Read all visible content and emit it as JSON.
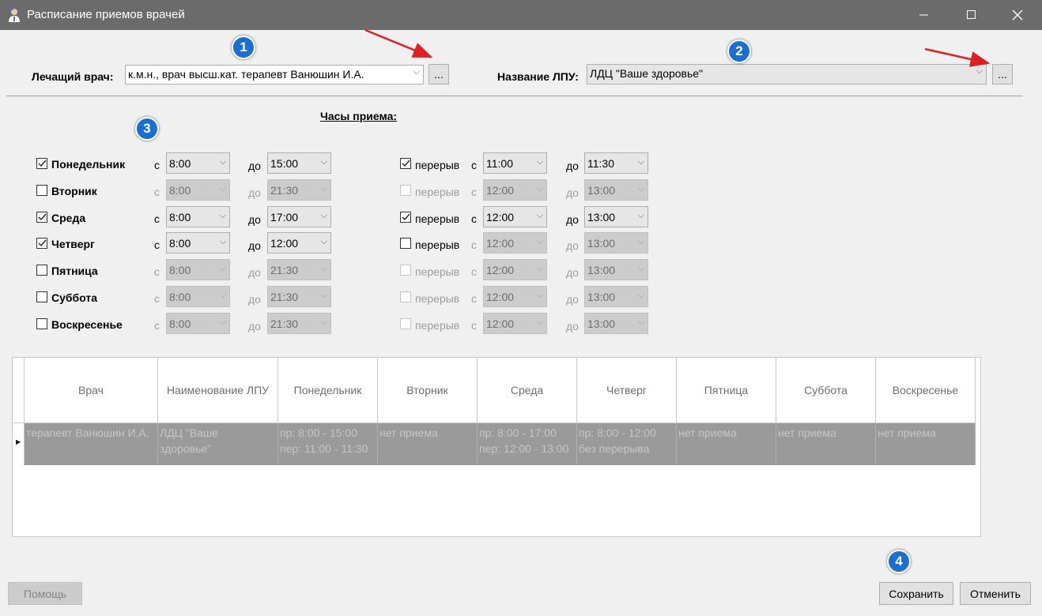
{
  "window": {
    "title": "Расписание приемов врачей"
  },
  "header": {
    "doctor_label": "Лечащий врач:",
    "doctor_value": "к.м.н., врач высш.кат. терапевт Ванюшин И.А.",
    "browse_label": "...",
    "lpu_label": "Название ЛПУ:",
    "lpu_value": "ЛДЦ \"Ваше здоровье\""
  },
  "hours_title": "Часы приема:",
  "from_label": "с",
  "to_label": "до",
  "break_label": "перерыв",
  "days": [
    {
      "name": "Понедельник",
      "checked": true,
      "from": "8:00",
      "to": "15:00",
      "break_checked": true,
      "break_from": "11:00",
      "break_to": "11:30"
    },
    {
      "name": "Вторник",
      "checked": false,
      "from": "8:00",
      "to": "21:30",
      "break_checked": false,
      "break_from": "12:00",
      "break_to": "13:00"
    },
    {
      "name": "Среда",
      "checked": true,
      "from": "8:00",
      "to": "17:00",
      "break_checked": true,
      "break_from": "12:00",
      "break_to": "13:00"
    },
    {
      "name": "Четверг",
      "checked": true,
      "from": "8:00",
      "to": "12:00",
      "break_checked": false,
      "break_from": "12:00",
      "break_to": "13:00"
    },
    {
      "name": "Пятница",
      "checked": false,
      "from": "8:00",
      "to": "21:30",
      "break_checked": false,
      "break_from": "12:00",
      "break_to": "13:00"
    },
    {
      "name": "Суббота",
      "checked": false,
      "from": "8:00",
      "to": "21:30",
      "break_checked": false,
      "break_from": "12:00",
      "break_to": "13:00"
    },
    {
      "name": "Воскресенье",
      "checked": false,
      "from": "8:00",
      "to": "21:30",
      "break_checked": false,
      "break_from": "12:00",
      "break_to": "13:00"
    }
  ],
  "table": {
    "columns": [
      "Врач",
      "Наименование ЛПУ",
      "Понедельник",
      "Вторник",
      "Среда",
      "Четверг",
      "Пятница",
      "Суббота",
      "Воскресенье"
    ],
    "row": [
      [
        "терапевт Ванюшин И.А."
      ],
      [
        "ЛДЦ \"Ваше",
        "здоровье\""
      ],
      [
        "пр: 8:00 - 15:00",
        "пер: 11:00 - 11:30"
      ],
      [
        "нет приема"
      ],
      [
        "пр: 8:00 - 17:00",
        "пер: 12:00 - 13:00"
      ],
      [
        "пр: 8:00 - 12:00",
        "без перерыва"
      ],
      [
        "нет приема"
      ],
      [
        "нет приема"
      ],
      [
        "нет приема"
      ]
    ]
  },
  "footer": {
    "help": "Помощь",
    "save": "Сохранить",
    "cancel": "Отменить"
  },
  "badges": [
    "1",
    "2",
    "3",
    "4"
  ],
  "colors": {
    "badge": "#1b6fd1",
    "arrow": "#e02020",
    "titlebar": "#6b6b6b",
    "row_selected": "#9a9a9a"
  }
}
